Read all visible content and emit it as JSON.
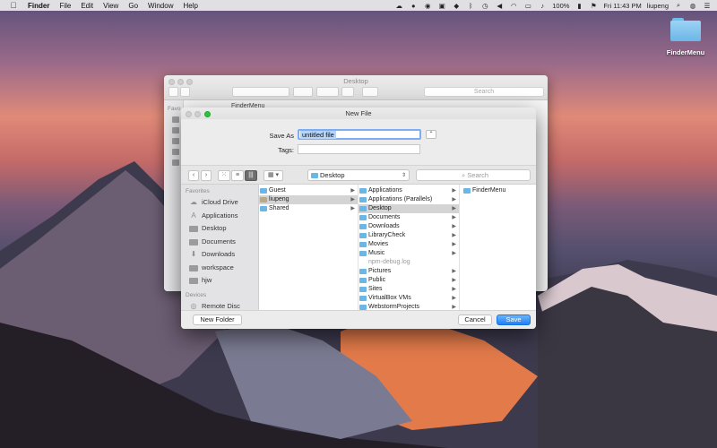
{
  "menubar": {
    "app": "Finder",
    "items": [
      "File",
      "Edit",
      "View",
      "Go",
      "Window",
      "Help"
    ],
    "battery": "100%",
    "datetime": "Fri 11:43 PM",
    "user": "liupeng"
  },
  "desktop": {
    "icon_label": "FinderMenu"
  },
  "bg_window": {
    "title": "Desktop",
    "search_placeholder": "Search",
    "sidebar_label": "Favo",
    "partial_item": "FinderMenu"
  },
  "dialog": {
    "title": "New File",
    "save_as_label": "Save As",
    "filename": "untitled file",
    "tags_label": "Tags:",
    "location": "Desktop",
    "search_placeholder": "Search",
    "sidebar": {
      "favorites_header": "Favorites",
      "favorites": [
        "iCloud Drive",
        "Applications",
        "Desktop",
        "Documents",
        "Downloads",
        "workspace",
        "hjw"
      ],
      "devices_header": "Devices",
      "devices": [
        "Remote Disc"
      ]
    },
    "col1": [
      "Guest",
      "liupeng",
      "Shared"
    ],
    "col2": [
      "Applications",
      "Applications (Parallels)",
      "Desktop",
      "Documents",
      "Downloads",
      "LibraryCheck",
      "Movies",
      "Music",
      "npm-debug.log",
      "Pictures",
      "Public",
      "Sites",
      "VirtualBox VMs",
      "WebstormProjects"
    ],
    "col3": [
      "FinderMenu"
    ],
    "new_folder": "New Folder",
    "cancel": "Cancel",
    "save": "Save"
  }
}
